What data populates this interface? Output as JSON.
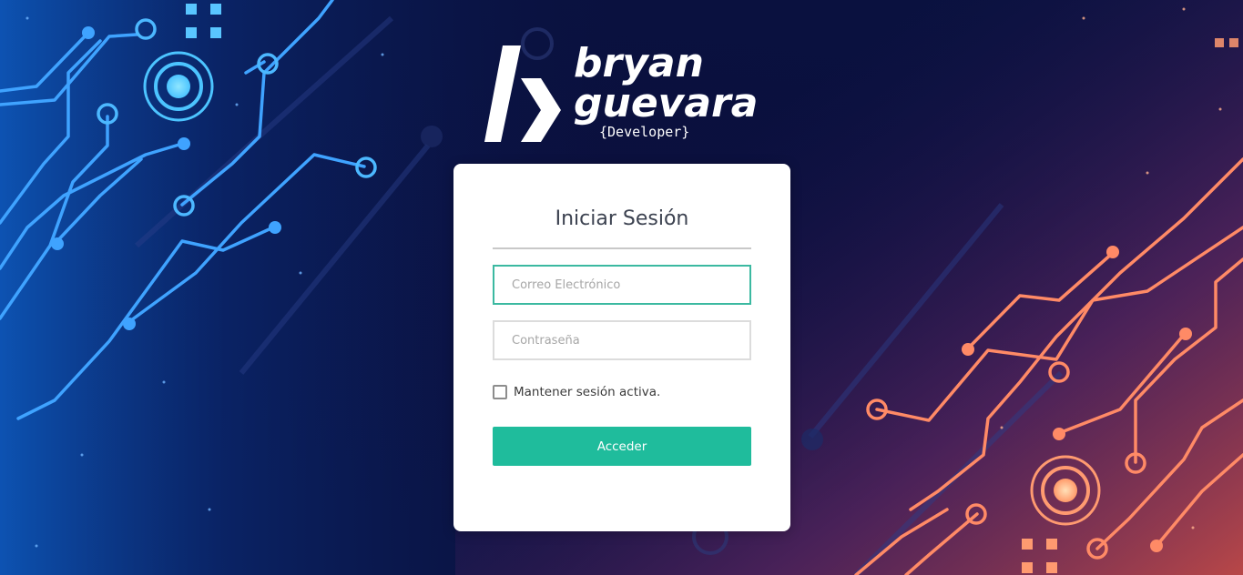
{
  "brand": {
    "line1": "bryan",
    "line2": "guevara",
    "tagline": "{Developer}"
  },
  "login": {
    "title": "Iniciar Sesión",
    "email_placeholder": "Correo Electrónico",
    "email_value": "",
    "password_placeholder": "Contraseña",
    "password_value": "",
    "remember_label": "Mantener sesión activa.",
    "remember_checked": false,
    "submit_label": "Acceder"
  },
  "colors": {
    "accent": "#1fbc9c",
    "focus_border": "#3bb9a1",
    "background_left": "#0c4aa8",
    "background_right": "#c8533f"
  },
  "icons": {
    "logo_mark": "b-logo-icon",
    "checkbox": "checkbox-icon"
  }
}
